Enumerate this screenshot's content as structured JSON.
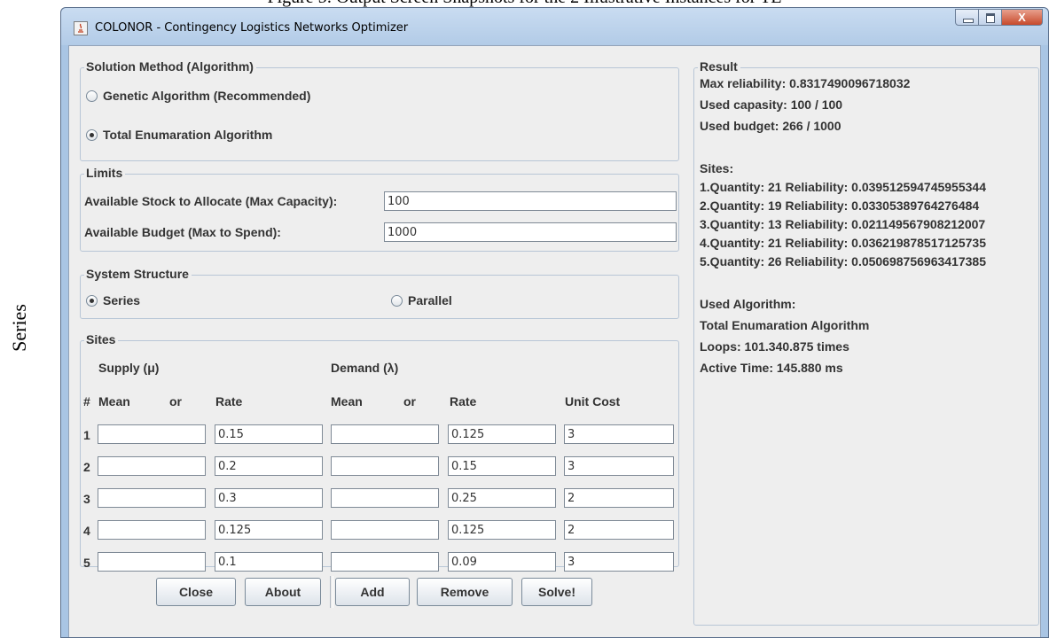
{
  "document": {
    "caption": "Figure 5: Output Screen Snapshots for the 2 Illustrative Instances for TE",
    "side_label": "Series"
  },
  "window": {
    "title": "COLONOR - Contingency Logistics Networks Optimizer",
    "close_glyph": "X"
  },
  "solution_method": {
    "legend": "Solution Method (Algorithm)",
    "options": [
      {
        "label": "Genetic Algorithm (Recommended)",
        "selected": false
      },
      {
        "label": "Total Enumaration Algorithm",
        "selected": true
      }
    ]
  },
  "limits": {
    "legend": "Limits",
    "capacity_label": "Available Stock to Allocate (Max Capacity):",
    "capacity_value": "100",
    "budget_label": "Available Budget (Max to Spend):",
    "budget_value": "1000"
  },
  "system_structure": {
    "legend": "System Structure",
    "options": [
      {
        "label": "Series",
        "selected": true
      },
      {
        "label": "Parallel",
        "selected": false
      }
    ]
  },
  "sites": {
    "legend": "Sites",
    "supply_header": "Supply (μ)",
    "demand_header": "Demand (λ)",
    "columns": {
      "hash": "#",
      "supply_mean": "Mean",
      "supply_or": "or",
      "supply_rate": "Rate",
      "demand_mean": "Mean",
      "demand_or": "or",
      "demand_rate": "Rate",
      "unit_cost": "Unit Cost"
    },
    "rows": [
      {
        "num": "1",
        "supply_mean": "",
        "supply_rate": "0.15",
        "demand_mean": "",
        "demand_rate": "0.125",
        "unit_cost": "3"
      },
      {
        "num": "2",
        "supply_mean": "",
        "supply_rate": "0.2",
        "demand_mean": "",
        "demand_rate": "0.15",
        "unit_cost": "3"
      },
      {
        "num": "3",
        "supply_mean": "",
        "supply_rate": "0.3",
        "demand_mean": "",
        "demand_rate": "0.25",
        "unit_cost": "2"
      },
      {
        "num": "4",
        "supply_mean": "",
        "supply_rate": "0.125",
        "demand_mean": "",
        "demand_rate": "0.125",
        "unit_cost": "2"
      },
      {
        "num": "5",
        "supply_mean": "",
        "supply_rate": "0.1",
        "demand_mean": "",
        "demand_rate": "0.09",
        "unit_cost": "3"
      }
    ]
  },
  "buttons": {
    "close": "Close",
    "about": "About",
    "add": "Add",
    "remove": "Remove",
    "solve": "Solve!"
  },
  "result": {
    "legend": "Result",
    "lines": [
      "Max reliability: 0.8317490096718032",
      "Used capasity: 100 / 100",
      "Used budget: 266 / 1000",
      "",
      "Sites:",
      "1.Quantity: 21 Reliability: 0.039512594745955344",
      "2.Quantity: 19 Reliability: 0.03305389764276484",
      "3.Quantity: 13 Reliability: 0.021149567908212007",
      "4.Quantity: 21 Reliability: 0.036219878517125735",
      "5.Quantity: 26 Reliability: 0.050698756963417385",
      "",
      "Used Algorithm:",
      "Total Enumaration Algorithm",
      "Loops: 101.340.875 times",
      "Active Time: 145.880 ms"
    ]
  }
}
